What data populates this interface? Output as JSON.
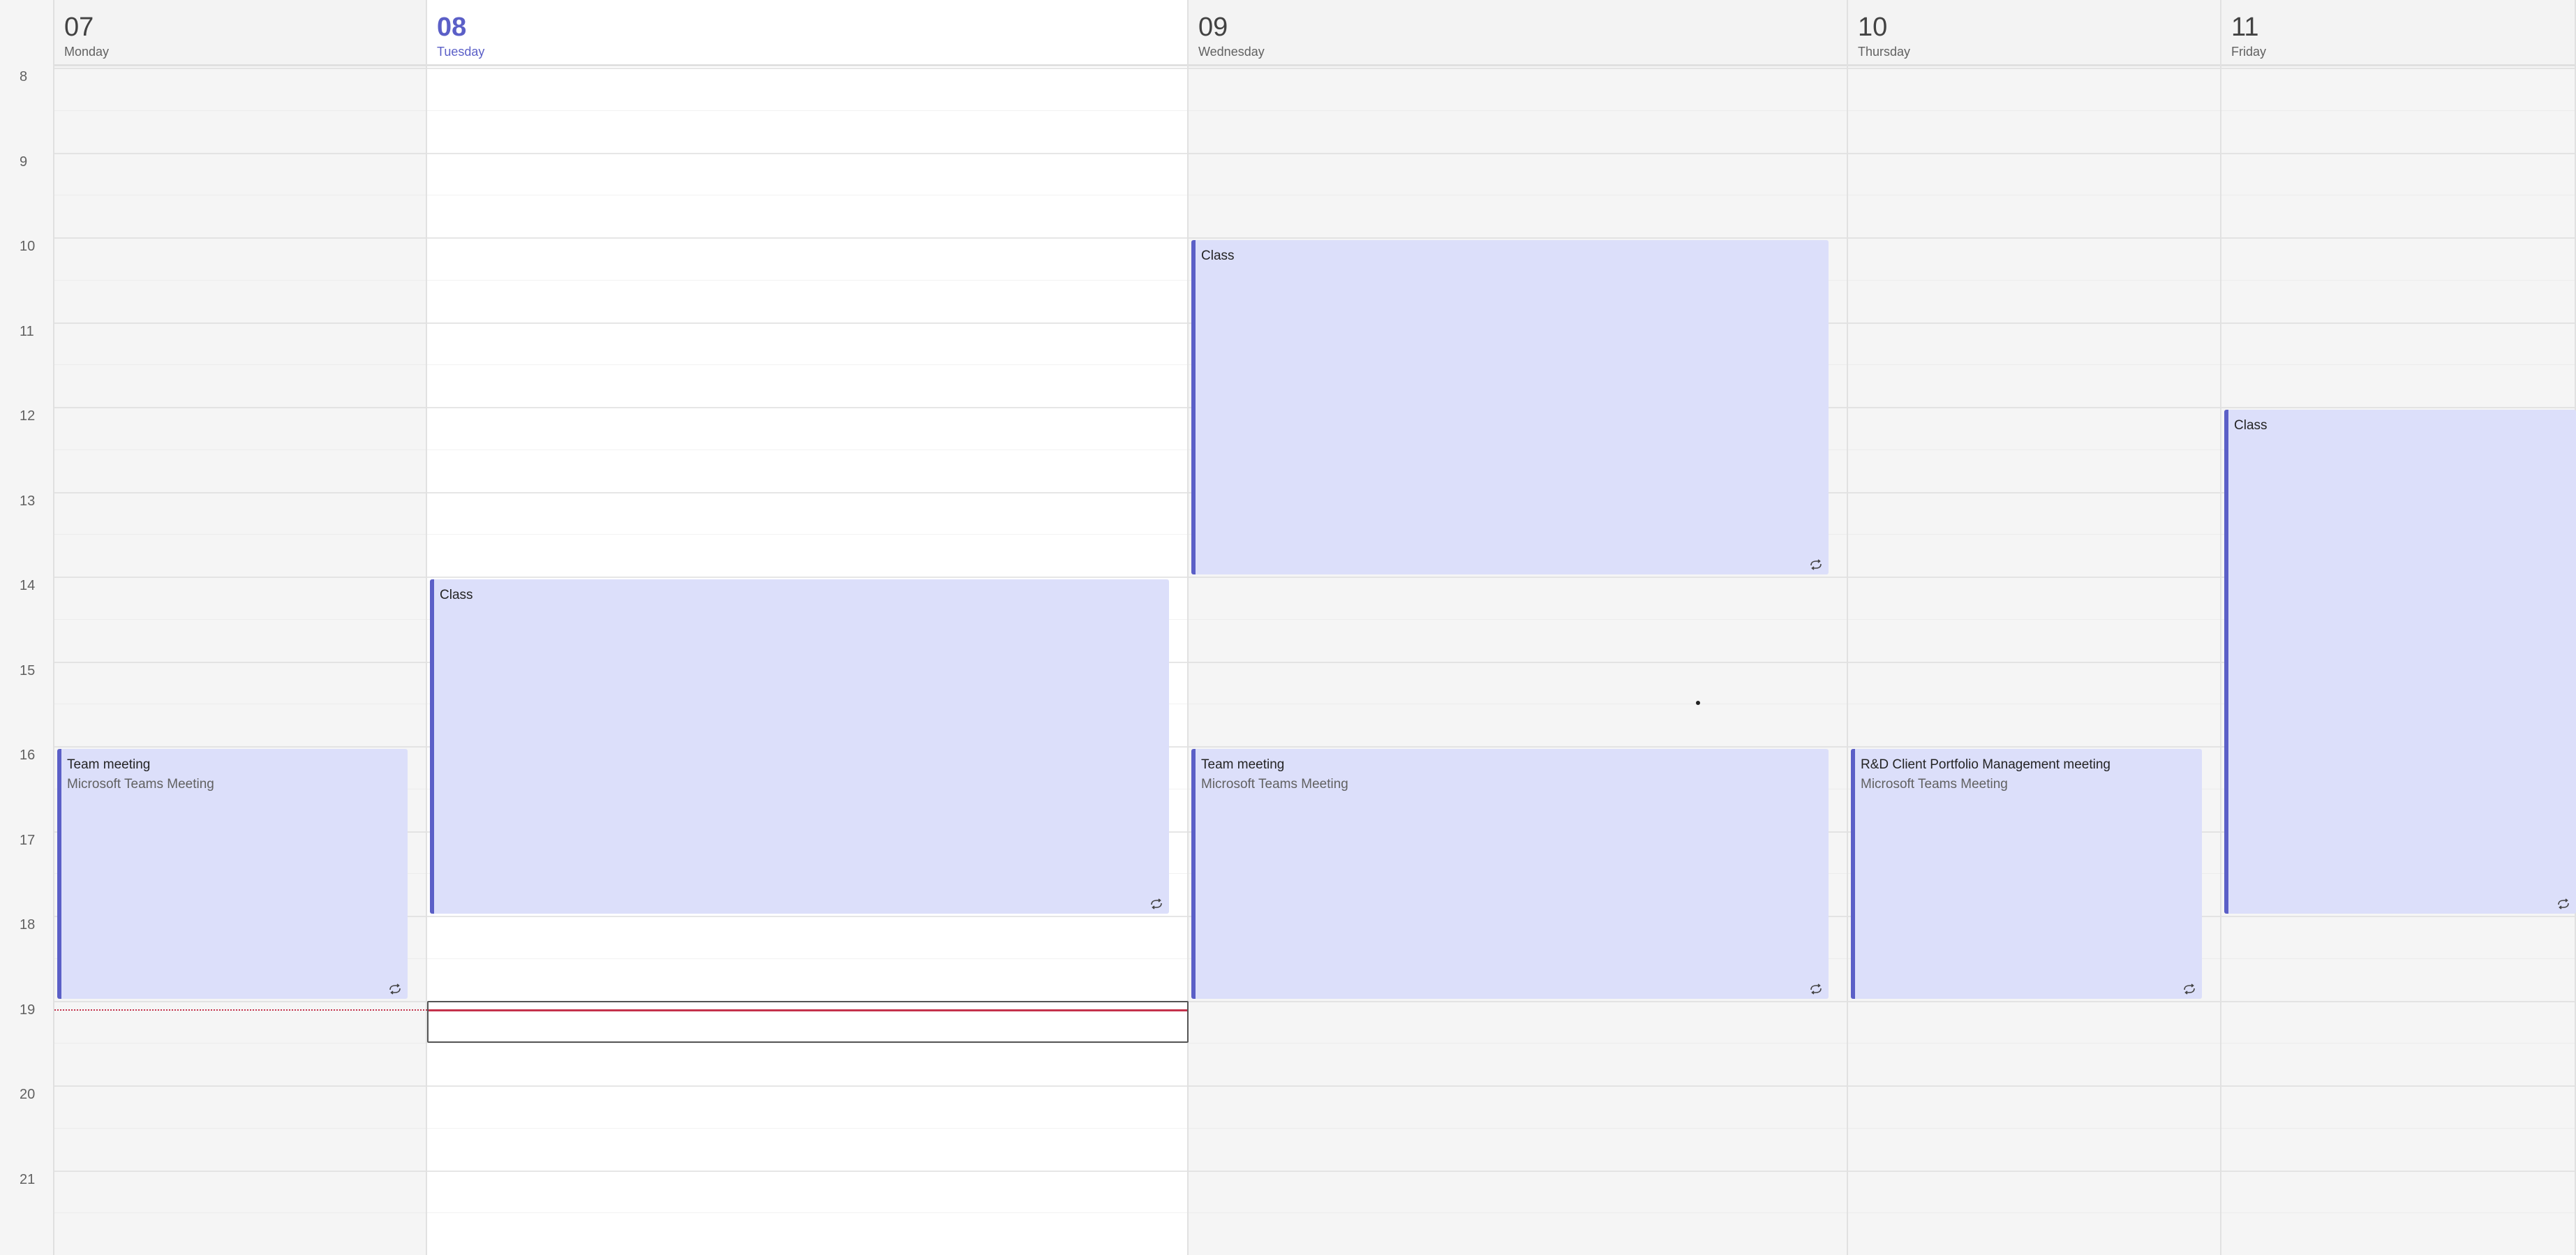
{
  "hours": [
    "8",
    "9",
    "10",
    "11",
    "12",
    "13",
    "14",
    "15",
    "16",
    "17",
    "18",
    "19",
    "20",
    "21"
  ],
  "days": [
    {
      "num": "07",
      "name": "Monday",
      "is_today": false
    },
    {
      "num": "08",
      "name": "Tuesday",
      "is_today": true
    },
    {
      "num": "09",
      "name": "Wednesday",
      "is_today": false
    },
    {
      "num": "10",
      "name": "Thursday",
      "is_today": false
    },
    {
      "num": "11",
      "name": "Friday",
      "is_today": false
    }
  ],
  "events": [
    {
      "day": 0,
      "start": 16,
      "end": 19,
      "title": "Team meeting",
      "subtitle": "Microsoft Teams Meeting",
      "recurring": true
    },
    {
      "day": 1,
      "start": 14,
      "end": 18,
      "title": "Class",
      "subtitle": "",
      "recurring": true
    },
    {
      "day": 2,
      "start": 10,
      "end": 14,
      "title": "Class",
      "subtitle": "",
      "recurring": true
    },
    {
      "day": 2,
      "start": 16,
      "end": 19,
      "title": "Team meeting",
      "subtitle": "Microsoft Teams Meeting",
      "recurring": true
    },
    {
      "day": 3,
      "start": 16,
      "end": 19,
      "title": "R&D Client Portfolio Management meeting",
      "subtitle": "Microsoft Teams Meeting",
      "recurring": true
    },
    {
      "day": 4,
      "start": 12,
      "end": 18,
      "title": "Class",
      "subtitle": "",
      "recurring": true
    }
  ],
  "current_time_hour": 19.1,
  "selected_slot": {
    "day": 1,
    "start": 19,
    "end": 19.5
  },
  "colors": {
    "accent": "#5b5fc7",
    "event_fill": "#dcdffa",
    "now_line": "#c4314b"
  },
  "icons": {
    "recurring": "recurring-icon"
  }
}
